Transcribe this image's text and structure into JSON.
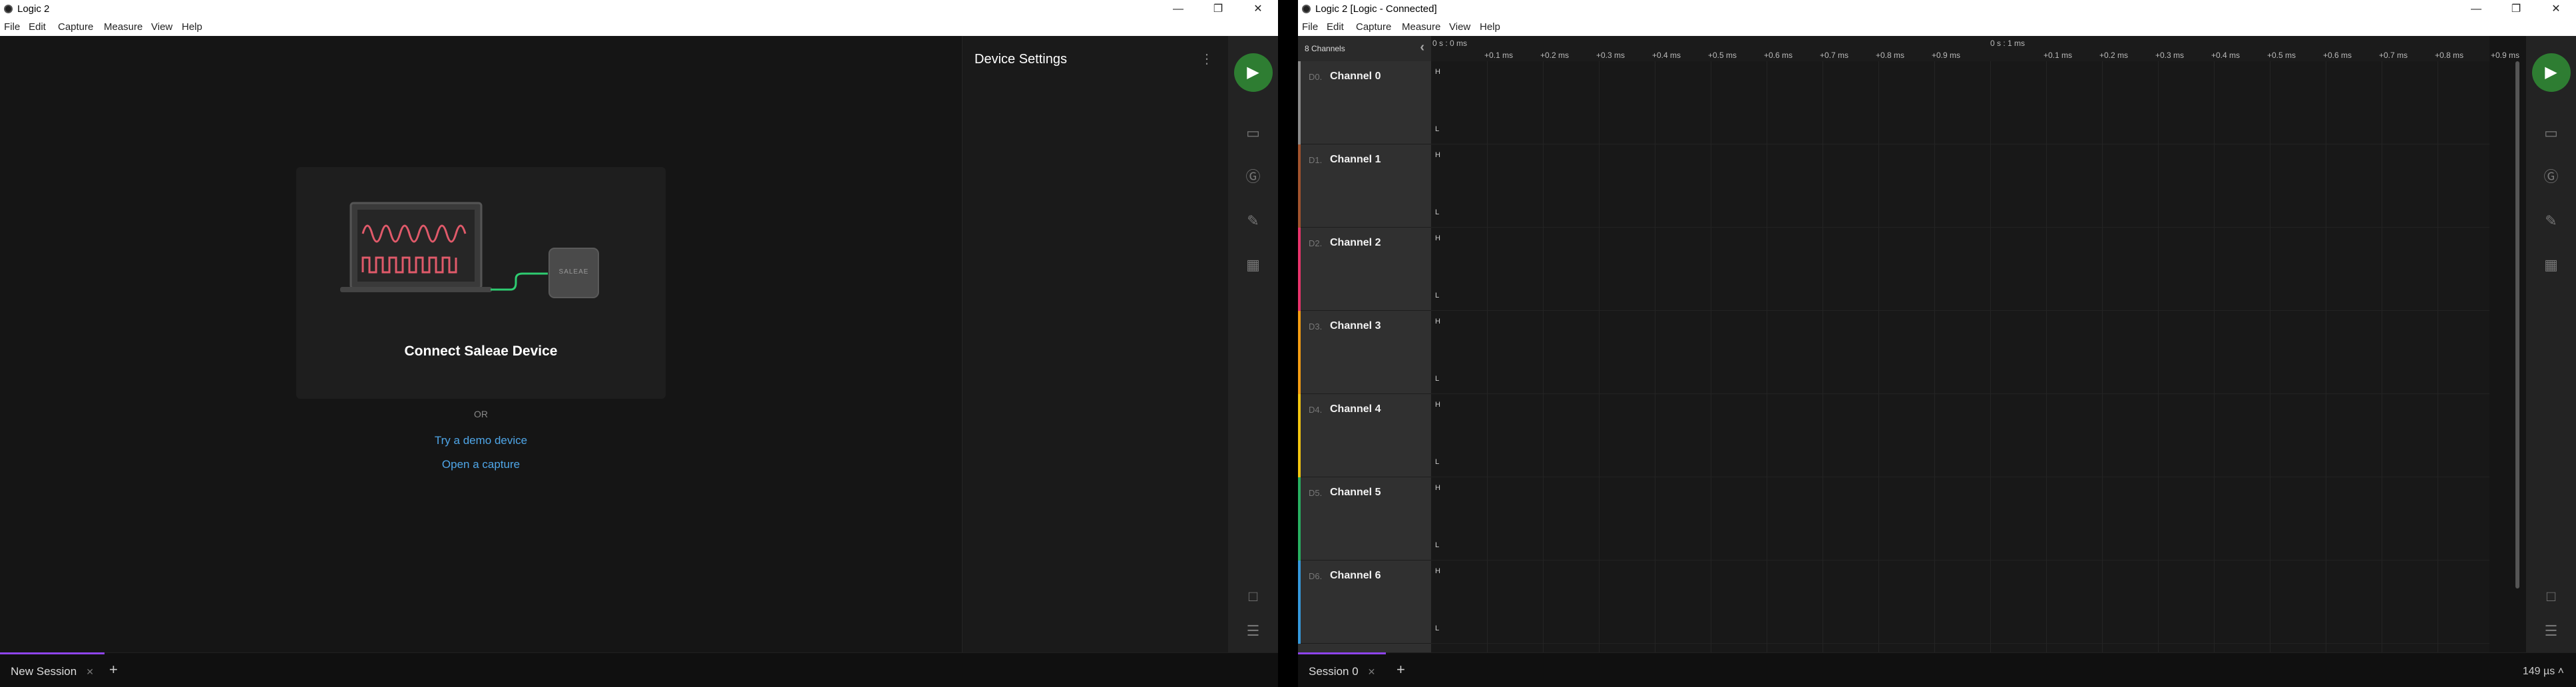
{
  "left_window": {
    "title": "Logic 2",
    "menu": [
      "File",
      "Edit",
      "Capture",
      "Measure",
      "View",
      "Help"
    ],
    "card_title": "Connect Saleae Device",
    "device_label": "SALEAE",
    "or_text": "OR",
    "demo_link": "Try a demo device",
    "open_link": "Open a capture",
    "panel_title": "Device Settings",
    "tab_label": "New Session"
  },
  "right_window": {
    "title": "Logic 2 [Logic - Connected]",
    "menu": [
      "File",
      "Edit",
      "Capture",
      "Measure",
      "View",
      "Help"
    ],
    "channels_header": "8 Channels",
    "time_start": "0 s : 0 ms",
    "time_mid": "0 s : 1 ms",
    "ticks_first": [
      "+0.1 ms",
      "+0.2 ms",
      "+0.3 ms",
      "+0.4 ms",
      "+0.5 ms",
      "+0.6 ms",
      "+0.7 ms",
      "+0.8 ms",
      "+0.9 ms"
    ],
    "ticks_second": [
      "+0.1 ms",
      "+0.2 ms",
      "+0.3 ms",
      "+0.4 ms",
      "+0.5 ms",
      "+0.6 ms",
      "+0.7 ms",
      "+0.8 ms",
      "+0.9 ms"
    ],
    "channels": [
      {
        "idx": "D0.",
        "name": "Channel 0",
        "color": "#8a8a8a"
      },
      {
        "idx": "D1.",
        "name": "Channel 1",
        "color": "#a0522d"
      },
      {
        "idx": "D2.",
        "name": "Channel 2",
        "color": "#e8336b"
      },
      {
        "idx": "D3.",
        "name": "Channel 3",
        "color": "#f39c12"
      },
      {
        "idx": "D4.",
        "name": "Channel 4",
        "color": "#f1c40f"
      },
      {
        "idx": "D5.",
        "name": "Channel 5",
        "color": "#27ae60"
      },
      {
        "idx": "D6.",
        "name": "Channel 6",
        "color": "#3498db"
      }
    ],
    "high_label": "H",
    "low_label": "L",
    "tab_label": "Session 0",
    "zoom_readout": "149 µs"
  },
  "colors": {
    "accent_play": "#2e7d32",
    "link": "#4fa6e8",
    "tab_underline": "#8e44ec"
  }
}
